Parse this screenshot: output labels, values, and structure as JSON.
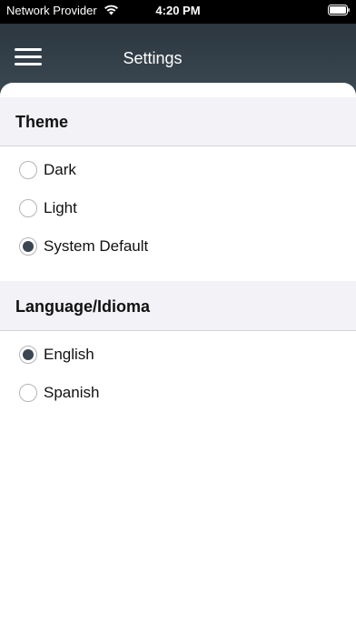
{
  "status_bar": {
    "carrier": "Network Provider",
    "time": "4:20 PM",
    "wifi_icon": "wifi-icon",
    "battery_icon": "battery-icon"
  },
  "header": {
    "title": "Settings",
    "menu_icon": "hamburger-menu-icon"
  },
  "sections": {
    "theme": {
      "title": "Theme",
      "options": [
        {
          "label": "Dark",
          "selected": false
        },
        {
          "label": "Light",
          "selected": false
        },
        {
          "label": "System Default",
          "selected": true
        }
      ]
    },
    "language": {
      "title": "Language/Idioma",
      "options": [
        {
          "label": "English",
          "selected": true
        },
        {
          "label": "Spanish",
          "selected": false
        }
      ]
    }
  },
  "colors": {
    "header_bg": "#2f3b44",
    "radio_selected": "#3a4651",
    "section_bg": "#f2f2f7"
  }
}
